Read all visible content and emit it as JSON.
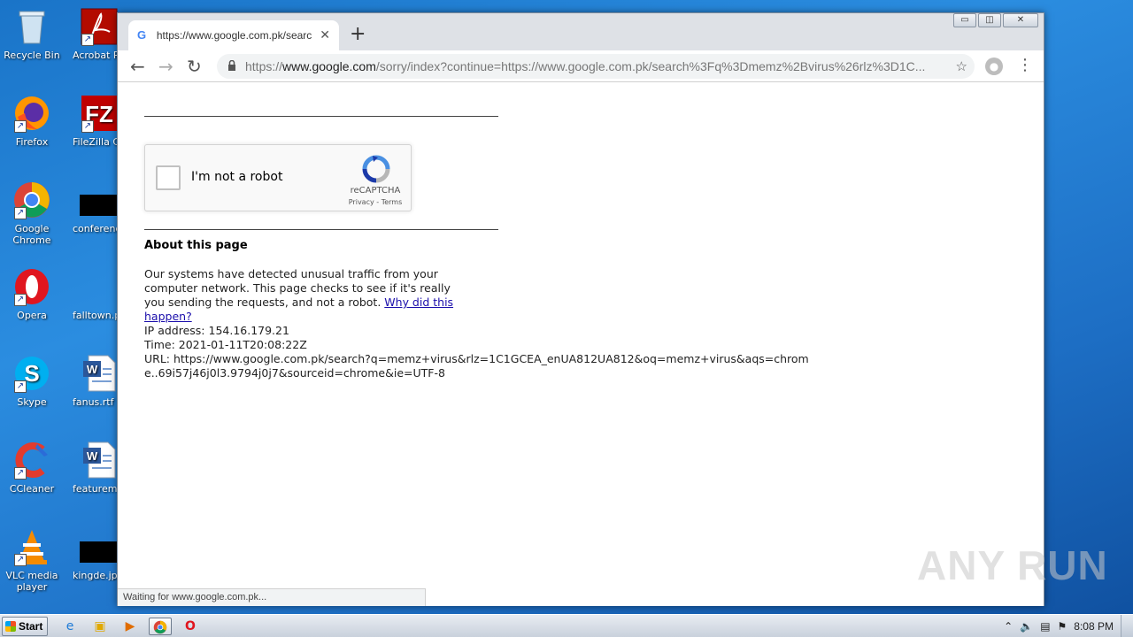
{
  "desktop": {
    "icons": [
      {
        "label": "Recycle Bin"
      },
      {
        "label": "Firefox"
      },
      {
        "label": "Google Chrome"
      },
      {
        "label": "Opera"
      },
      {
        "label": "Skype"
      },
      {
        "label": "CCleaner"
      },
      {
        "label": "VLC media player"
      },
      {
        "label": "Acrobat Reader D"
      },
      {
        "label": "FileZilla Clie"
      },
      {
        "label": "conference"
      },
      {
        "label": "falltown.p"
      },
      {
        "label": "fanus.rtf"
      },
      {
        "label": "featuremap"
      },
      {
        "label": "kingde.jp"
      }
    ]
  },
  "browser": {
    "tab": {
      "title": "https://www.google.com.pk/search?",
      "favicon": "G"
    },
    "omnibox": {
      "url_prefix": "https://",
      "url_host": "www.google.com",
      "url_rest": "/sorry/index?continue=https://www.google.com.pk/search%3Fq%3Dmemz%2Bvirus%26rlz%3D1C..."
    },
    "status": "Waiting for www.google.com.pk..."
  },
  "page": {
    "captcha": {
      "checkbox_label": "I'm not a robot",
      "brand": "reCAPTCHA",
      "links": "Privacy - Terms"
    },
    "about": {
      "title": "About this page",
      "body": "Our systems have detected unusual traffic from your computer network. This page checks to see if it's really you sending the requests, and not a robot. ",
      "link": "Why did this happen?"
    },
    "info": {
      "ip": "IP address: 154.16.179.21",
      "time": "Time: 2021-01-11T20:08:22Z",
      "url": "URL: https://www.google.com.pk/search?q=memz+virus&rlz=1C1GCEA_enUA812UA812&oq=memz+virus&aqs=chrome..69i57j46j0l3.9794j0j7&sourceid=chrome&ie=UTF-8"
    }
  },
  "watermark": "ANY RUN",
  "taskbar": {
    "start_label": "Start",
    "clock": "8:08 PM"
  }
}
